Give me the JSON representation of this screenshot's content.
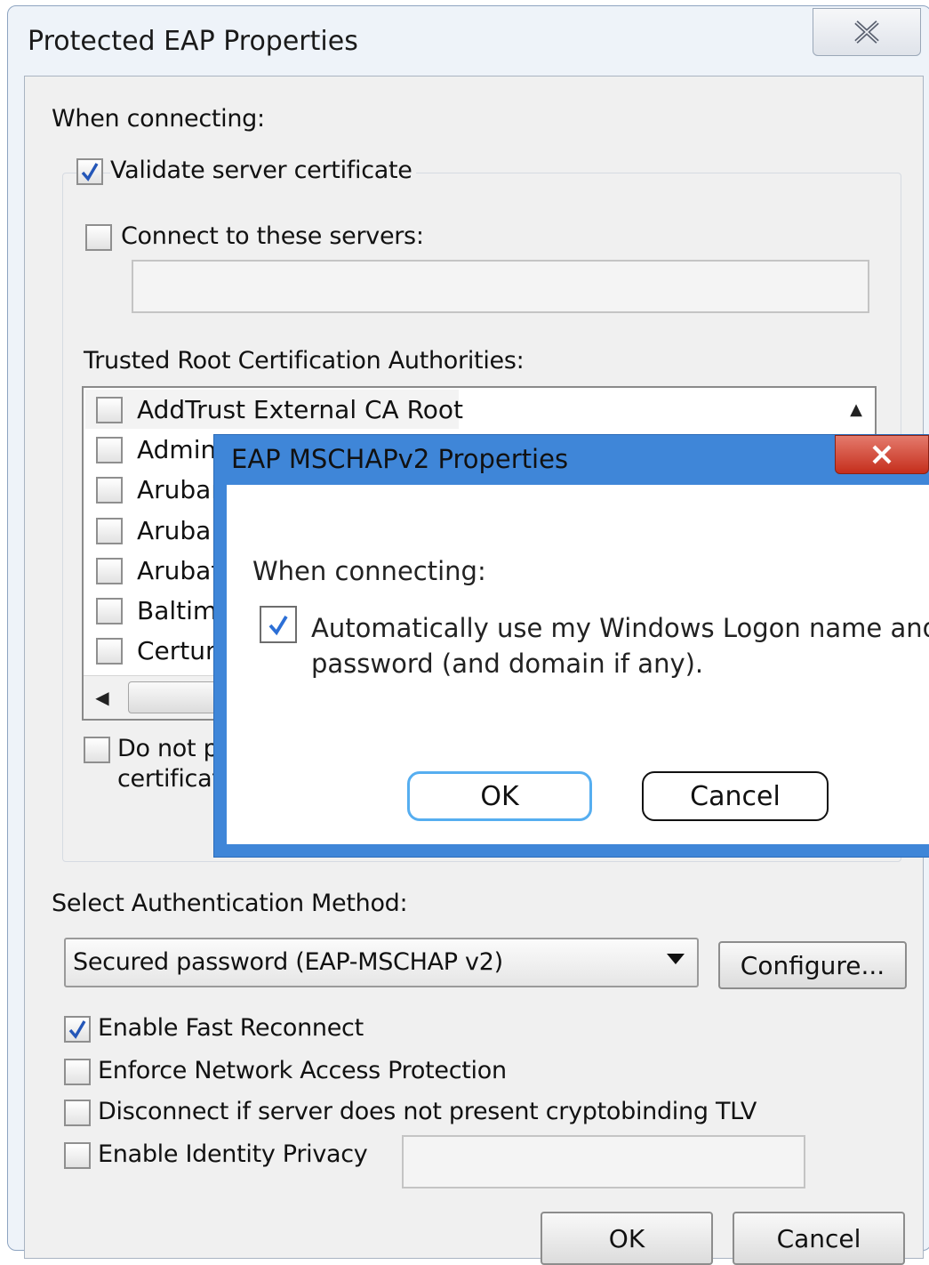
{
  "window": {
    "title": "Protected EAP Properties",
    "close_icon": "close-icon"
  },
  "connecting": {
    "heading": "When connecting:",
    "validate_label": "Validate server certificate",
    "validate_checked": true,
    "connect_servers_label": "Connect to these servers:",
    "connect_servers_checked": false,
    "servers_value": "",
    "trusted_root_label": "Trusted Root Certification Authorities:",
    "ca_list": [
      {
        "label": "AddTrust External CA Root",
        "checked": false
      },
      {
        "label": "Admini",
        "checked": false
      },
      {
        "label": "Arubar",
        "checked": false
      },
      {
        "label": "Aruba",
        "checked": false
      },
      {
        "label": "Arubat",
        "checked": false
      },
      {
        "label": "Baltim",
        "checked": false
      },
      {
        "label": "Certun",
        "checked": false
      }
    ],
    "do_not_prompt_line1": "Do not p",
    "do_not_prompt_line2": "certificat",
    "do_not_prompt_checked": false
  },
  "auth": {
    "heading": "Select Authentication Method:",
    "method_selected": "Secured password (EAP-MSCHAP v2)",
    "configure_label": "Configure...",
    "options": [
      {
        "label": "Enable Fast Reconnect",
        "checked": true
      },
      {
        "label": "Enforce Network Access Protection",
        "checked": false
      },
      {
        "label": "Disconnect if server does not present cryptobinding TLV",
        "checked": false
      },
      {
        "label": "Enable Identity Privacy",
        "checked": false
      }
    ],
    "identity_value": ""
  },
  "footer": {
    "ok_label": "OK",
    "cancel_label": "Cancel"
  },
  "popup": {
    "title": "EAP MSCHAPv2 Properties",
    "heading": "When connecting:",
    "auto_logon_line1": "Automatically use my Windows Logon name and",
    "auto_logon_line2": "password (and domain if any).",
    "auto_logon_checked": true,
    "ok_label": "OK",
    "cancel_label": "Cancel"
  },
  "colors": {
    "popup_frame": "#3f86d8",
    "close_red": "#c52e1c",
    "ok_focus": "#56aef0"
  }
}
